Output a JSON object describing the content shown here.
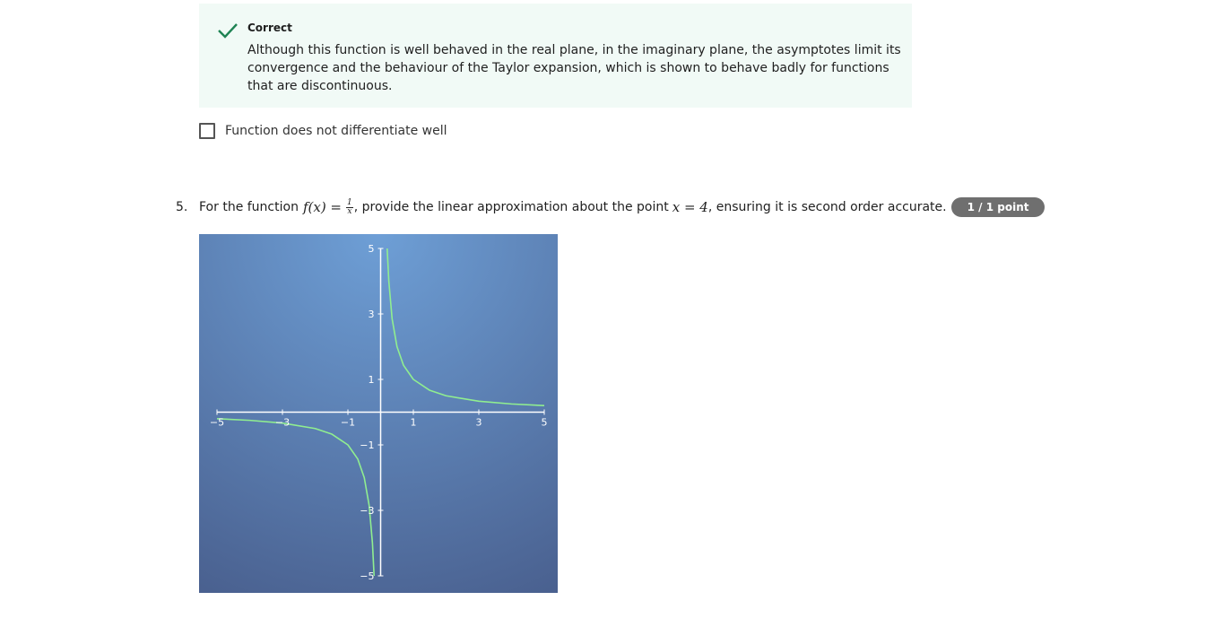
{
  "feedback": {
    "status": "Correct",
    "message": "Although this function is well behaved in the real plane, in the imaginary plane, the asymptotes limit its convergence and the behaviour of the Taylor expansion, which is shown to behave badly for functions that are discontinuous.",
    "color": "#1f8354",
    "background": "#f1faf6",
    "icon": "check-icon"
  },
  "option": {
    "label": "Function does not differentiate well",
    "checked": false
  },
  "question": {
    "number": "5.",
    "text_before": "For the function",
    "math_fx": "f(x) =",
    "frac_num": "1",
    "frac_den": "x",
    "text_middle": ", provide the linear approximation about the point",
    "math_point": "x = 4",
    "text_after": ", ensuring it is second order accurate.",
    "points": "1 / 1 point"
  },
  "chart_data": {
    "type": "line",
    "function": "f(x) = 1/x",
    "xlim": [
      -5,
      5
    ],
    "ylim": [
      -5,
      5
    ],
    "x_ticks": [
      "−5",
      "−3",
      "−1",
      "1",
      "3",
      "5"
    ],
    "y_ticks": [
      "5",
      "3",
      "1",
      "−1",
      "−3",
      "−5"
    ],
    "series": [
      {
        "color": "#90ee90",
        "segments": [
          {
            "x": [
              -5,
              -4,
              -3,
              -2,
              -1.5,
              -1,
              -0.7,
              -0.5,
              -0.35,
              -0.25,
              -0.2
            ],
            "y": [
              -0.2,
              -0.25,
              -0.333,
              -0.5,
              -0.667,
              -1,
              -1.429,
              -2,
              -2.857,
              -4,
              -5
            ]
          },
          {
            "x": [
              0.2,
              0.25,
              0.35,
              0.5,
              0.7,
              1,
              1.5,
              2,
              3,
              4,
              5
            ],
            "y": [
              5,
              4,
              2.857,
              2,
              1.429,
              1,
              0.667,
              0.5,
              0.333,
              0.25,
              0.2
            ]
          }
        ]
      }
    ],
    "background_colors": [
      "#6e9fd6",
      "#4a6190"
    ],
    "axis_color": "#ffffff",
    "grid": false
  }
}
